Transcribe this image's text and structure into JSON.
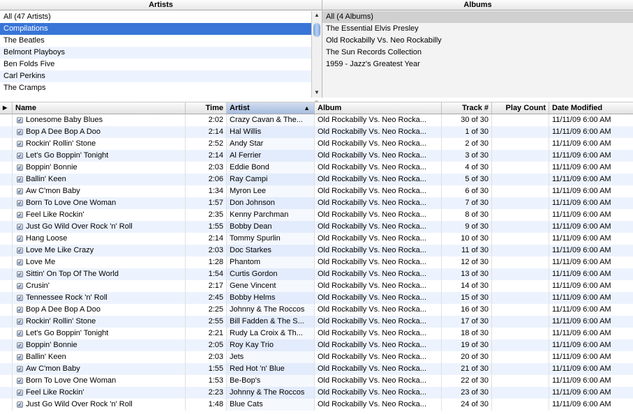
{
  "artists_pane": {
    "title": "Artists",
    "items": [
      {
        "label": "All (47 Artists)",
        "selected": false
      },
      {
        "label": "Compilations",
        "selected": true
      },
      {
        "label": "The Beatles",
        "selected": false
      },
      {
        "label": "Belmont Playboys",
        "selected": false
      },
      {
        "label": "Ben Folds Five",
        "selected": false
      },
      {
        "label": "Carl Perkins",
        "selected": false
      },
      {
        "label": "The Cramps",
        "selected": false
      }
    ]
  },
  "albums_pane": {
    "title": "Albums",
    "items": [
      {
        "label": "All (4 Albums)",
        "selected": true
      },
      {
        "label": "The Essential Elvis Presley",
        "selected": false
      },
      {
        "label": "Old Rockabilly Vs. Neo Rockabilly",
        "selected": false
      },
      {
        "label": "The Sun Records Collection",
        "selected": false
      },
      {
        "label": "1959 - Jazz's Greatest Year",
        "selected": false
      }
    ]
  },
  "track_list": {
    "columns": {
      "play": "▶",
      "name": "Name",
      "time": "Time",
      "artist": "Artist",
      "album": "Album",
      "track": "Track #",
      "plays": "Play Count",
      "date": "Date Modified"
    },
    "sort_column": "artist",
    "sort_arrow": "▲",
    "rows": [
      {
        "name": "Lonesome Baby Blues",
        "time": "2:02",
        "artist": "Crazy Cavan & The...",
        "album": "Old Rockabilly Vs. Neo Rocka...",
        "track": "30 of 30",
        "plays": "",
        "date": "11/11/09 6:00 AM"
      },
      {
        "name": "Bop A Dee Bop A Doo",
        "time": "2:14",
        "artist": "Hal Willis",
        "album": "Old Rockabilly Vs. Neo Rocka...",
        "track": "1 of 30",
        "plays": "",
        "date": "11/11/09 6:00 AM"
      },
      {
        "name": "Rockin' Rollin' Stone",
        "time": "2:52",
        "artist": "Andy Star",
        "album": "Old Rockabilly Vs. Neo Rocka...",
        "track": "2 of 30",
        "plays": "",
        "date": "11/11/09 6:00 AM"
      },
      {
        "name": "Let's Go Boppin' Tonight",
        "time": "2:14",
        "artist": "Al Ferrier",
        "album": "Old Rockabilly Vs. Neo Rocka...",
        "track": "3 of 30",
        "plays": "",
        "date": "11/11/09 6:00 AM"
      },
      {
        "name": "Boppin' Bonnie",
        "time": "2:03",
        "artist": "Eddie Bond",
        "album": "Old Rockabilly Vs. Neo Rocka...",
        "track": "4 of 30",
        "plays": "",
        "date": "11/11/09 6:00 AM"
      },
      {
        "name": "Ballin' Keen",
        "time": "2:06",
        "artist": "Ray Campi",
        "album": "Old Rockabilly Vs. Neo Rocka...",
        "track": "5 of 30",
        "plays": "",
        "date": "11/11/09 6:00 AM"
      },
      {
        "name": "Aw C'mon Baby",
        "time": "1:34",
        "artist": "Myron Lee",
        "album": "Old Rockabilly Vs. Neo Rocka...",
        "track": "6 of 30",
        "plays": "",
        "date": "11/11/09 6:00 AM"
      },
      {
        "name": "Born To Love One Woman",
        "time": "1:57",
        "artist": "Don Johnson",
        "album": "Old Rockabilly Vs. Neo Rocka...",
        "track": "7 of 30",
        "plays": "",
        "date": "11/11/09 6:00 AM"
      },
      {
        "name": "Feel Like Rockin'",
        "time": "2:35",
        "artist": "Kenny Parchman",
        "album": "Old Rockabilly Vs. Neo Rocka...",
        "track": "8 of 30",
        "plays": "",
        "date": "11/11/09 6:00 AM"
      },
      {
        "name": "Just Go Wild Over Rock 'n' Roll",
        "time": "1:55",
        "artist": "Bobby Dean",
        "album": "Old Rockabilly Vs. Neo Rocka...",
        "track": "9 of 30",
        "plays": "",
        "date": "11/11/09 6:00 AM"
      },
      {
        "name": "Hang Loose",
        "time": "2:14",
        "artist": "Tommy Spurlin",
        "album": "Old Rockabilly Vs. Neo Rocka...",
        "track": "10 of 30",
        "plays": "",
        "date": "11/11/09 6:00 AM"
      },
      {
        "name": "Love Me Like Crazy",
        "time": "2:03",
        "artist": "Doc Starkes",
        "album": "Old Rockabilly Vs. Neo Rocka...",
        "track": "11 of 30",
        "plays": "",
        "date": "11/11/09 6:00 AM"
      },
      {
        "name": "Love Me",
        "time": "1:28",
        "artist": "Phantom",
        "album": "Old Rockabilly Vs. Neo Rocka...",
        "track": "12 of 30",
        "plays": "",
        "date": "11/11/09 6:00 AM"
      },
      {
        "name": "Sittin' On Top Of The World",
        "time": "1:54",
        "artist": "Curtis Gordon",
        "album": "Old Rockabilly Vs. Neo Rocka...",
        "track": "13 of 30",
        "plays": "",
        "date": "11/11/09 6:00 AM"
      },
      {
        "name": "Crusin'",
        "time": "2:17",
        "artist": "Gene Vincent",
        "album": "Old Rockabilly Vs. Neo Rocka...",
        "track": "14 of 30",
        "plays": "",
        "date": "11/11/09 6:00 AM"
      },
      {
        "name": "Tennessee Rock 'n' Roll",
        "time": "2:45",
        "artist": "Bobby Helms",
        "album": "Old Rockabilly Vs. Neo Rocka...",
        "track": "15 of 30",
        "plays": "",
        "date": "11/11/09 6:00 AM"
      },
      {
        "name": "Bop A Dee Bop A Doo",
        "time": "2:25",
        "artist": "Johnny & The Roccos",
        "album": "Old Rockabilly Vs. Neo Rocka...",
        "track": "16 of 30",
        "plays": "",
        "date": "11/11/09 6:00 AM"
      },
      {
        "name": "Rockin' Rollin' Stone",
        "time": "2:55",
        "artist": "Bill Fadden & The S...",
        "album": "Old Rockabilly Vs. Neo Rocka...",
        "track": "17 of 30",
        "plays": "",
        "date": "11/11/09 6:00 AM"
      },
      {
        "name": "Let's Go Boppin' Tonight",
        "time": "2:21",
        "artist": "Rudy La Croix & Th...",
        "album": "Old Rockabilly Vs. Neo Rocka...",
        "track": "18 of 30",
        "plays": "",
        "date": "11/11/09 6:00 AM"
      },
      {
        "name": "Boppin' Bonnie",
        "time": "2:05",
        "artist": "Roy Kay Trio",
        "album": "Old Rockabilly Vs. Neo Rocka...",
        "track": "19 of 30",
        "plays": "",
        "date": "11/11/09 6:00 AM"
      },
      {
        "name": "Ballin' Keen",
        "time": "2:03",
        "artist": "Jets",
        "album": "Old Rockabilly Vs. Neo Rocka...",
        "track": "20 of 30",
        "plays": "",
        "date": "11/11/09 6:00 AM"
      },
      {
        "name": "Aw C'mon Baby",
        "time": "1:55",
        "artist": "Red Hot 'n' Blue",
        "album": "Old Rockabilly Vs. Neo Rocka...",
        "track": "21 of 30",
        "plays": "",
        "date": "11/11/09 6:00 AM"
      },
      {
        "name": "Born To Love One Woman",
        "time": "1:53",
        "artist": "Be-Bop's",
        "album": "Old Rockabilly Vs. Neo Rocka...",
        "track": "22 of 30",
        "plays": "",
        "date": "11/11/09 6:00 AM"
      },
      {
        "name": "Feel Like Rockin'",
        "time": "2:23",
        "artist": "Johnny & The Roccos",
        "album": "Old Rockabilly Vs. Neo Rocka...",
        "track": "23 of 30",
        "plays": "",
        "date": "11/11/09 6:00 AM"
      },
      {
        "name": "Just Go Wild Over Rock 'n' Roll",
        "time": "1:48",
        "artist": "Blue Cats",
        "album": "Old Rockabilly Vs. Neo Rocka...",
        "track": "24 of 30",
        "plays": "",
        "date": "11/11/09 6:00 AM"
      }
    ]
  },
  "icons": {
    "checkbox": "checkmark-icon",
    "scroll_up": "arrow-up-icon",
    "scroll_down": "arrow-down-icon"
  },
  "colors": {
    "selection": "#3875d7",
    "stripe": "#edf3fe",
    "sorted_header": "#a7bde0"
  }
}
